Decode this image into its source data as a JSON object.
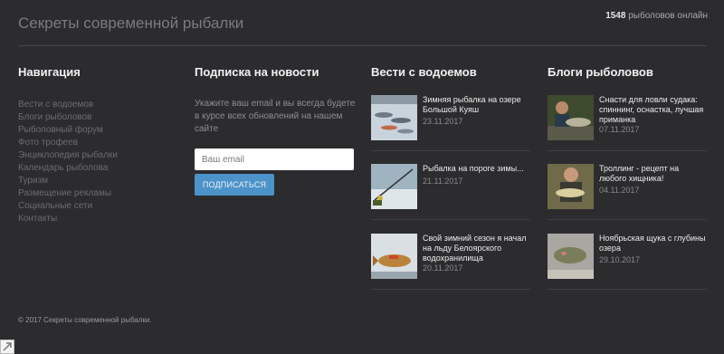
{
  "header": {
    "site_title": "Секреты современной рыбалки",
    "online_count": "1548",
    "online_label": "рыболовов онлайн"
  },
  "navigation": {
    "heading": "Навигация",
    "items": [
      {
        "label": "Вести с водоемов"
      },
      {
        "label": "Блоги рыболовов"
      },
      {
        "label": "Рыболовный форум"
      },
      {
        "label": "Фото трофеев"
      },
      {
        "label": "Энциклопедия рыбалки"
      },
      {
        "label": "Календарь рыболова"
      },
      {
        "label": "Туризм"
      },
      {
        "label": "Размещение рекламы"
      },
      {
        "label": "Социальные сети"
      },
      {
        "label": "Контакты"
      }
    ]
  },
  "subscribe": {
    "heading": "Подписка на новости",
    "text": "Укажите ваш email и вы всегда будете в курсе всех обновлений на нашем сайте",
    "email_placeholder": "Ваш email",
    "button_label": "ПОДПИСАТЬСЯ"
  },
  "news": {
    "heading": "Вести с водоемов",
    "items": [
      {
        "title": "Зимняя рыбалка на озере Большой Куяш",
        "date": "23.11.2017",
        "thumb": "ice-fish-thumbnail"
      },
      {
        "title": "Рыбалка на пороге зимы...",
        "date": "21.11.2017",
        "thumb": "winter-rod-thumbnail"
      },
      {
        "title": "Свой зимний сезон я начал на льду Белоярского водохранилища",
        "date": "20.11.2017",
        "thumb": "perch-on-ice-thumbnail"
      }
    ]
  },
  "blogs": {
    "heading": "Блоги рыболовов",
    "items": [
      {
        "title": "Снасти для ловли судака: спиннинг, оснастка, лучшая приманка",
        "date": "07.11.2017",
        "thumb": "zander-catch-thumbnail"
      },
      {
        "title": "Троллинг - рецепт на любого хищника!",
        "date": "04.11.2017",
        "thumb": "angler-with-fish-thumbnail"
      },
      {
        "title": "Ноябрьская щука с глубины озера",
        "date": "29.10.2017",
        "thumb": "pike-thumbnail"
      }
    ]
  },
  "footer": {
    "copyright": "© 2017 Секреты современной рыбалки."
  },
  "colors": {
    "background": "#2c2c2f",
    "accent_button": "#4c93c9",
    "heading": "#f2f2f2"
  }
}
